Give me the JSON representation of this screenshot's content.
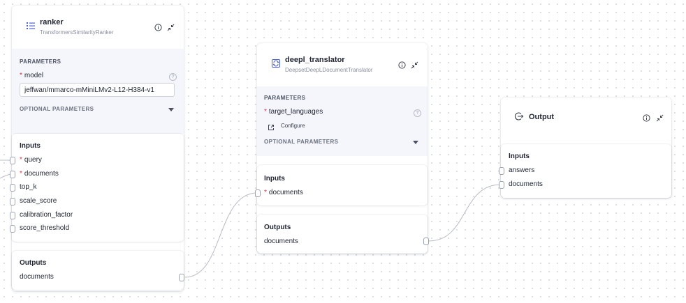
{
  "ranker": {
    "title": "ranker",
    "subtitle": "TransformersSimilarityRanker",
    "parameters_label": "PARAMETERS",
    "model_label": "model",
    "model_value": "jeffwan/mmarco-mMiniLMv2-L12-H384-v1",
    "optional_label": "OPTIONAL PARAMETERS",
    "inputs_label": "Inputs",
    "inputs": [
      {
        "name": "query",
        "required": "*"
      },
      {
        "name": "documents",
        "required": "*"
      },
      {
        "name": "top_k",
        "required": ""
      },
      {
        "name": "scale_score",
        "required": ""
      },
      {
        "name": "calibration_factor",
        "required": ""
      },
      {
        "name": "score_threshold",
        "required": ""
      }
    ],
    "outputs_label": "Outputs",
    "outputs": [
      {
        "name": "documents"
      }
    ]
  },
  "translator": {
    "title": "deepl_translator",
    "subtitle": "DeepsetDeepLDocumentTranslator",
    "parameters_label": "PARAMETERS",
    "target_label": "target_languages",
    "configure_label": "Configure",
    "optional_label": "OPTIONAL PARAMETERS",
    "inputs_label": "Inputs",
    "inputs": [
      {
        "name": "documents",
        "required": "*"
      }
    ],
    "outputs_label": "Outputs",
    "outputs": [
      {
        "name": "documents"
      }
    ]
  },
  "output": {
    "title": "Output",
    "inputs_label": "Inputs",
    "inputs": [
      {
        "name": "answers"
      },
      {
        "name": "documents"
      }
    ]
  },
  "colors": {
    "accent": "#4a5fcf",
    "required": "#d9364a",
    "edge": "#b9bcc4"
  }
}
